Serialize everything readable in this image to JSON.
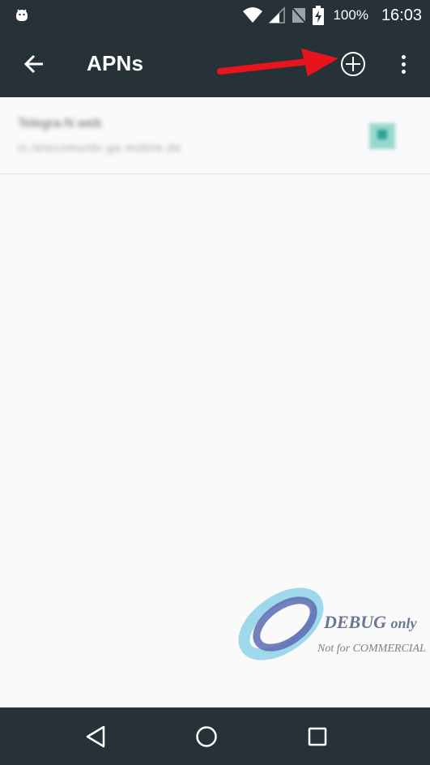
{
  "status_bar": {
    "battery_percent": "100%",
    "time": "16:03",
    "icons": [
      "android-debug-icon",
      "wifi-icon",
      "cell-signal-icon",
      "no-sim-icon",
      "battery-charging-icon"
    ]
  },
  "toolbar": {
    "title": "APNs",
    "back_icon": "arrow-back-icon",
    "add_icon": "add-circle-icon",
    "overflow_icon": "more-vert-icon"
  },
  "apn_list": [
    {
      "name": "Telegra-N web",
      "apn": "in.telecomunbr.ga.mobile.de",
      "selected": true
    }
  ],
  "watermark": {
    "debug": "DEBUG",
    "only": "only",
    "not_for": "Not for COMMERCIAL"
  },
  "nav_bar": {
    "icons": [
      "back-triangle-icon",
      "home-circle-icon",
      "recents-square-icon"
    ]
  },
  "colors": {
    "bar_bg": "#263238",
    "accent": "#2aa394",
    "annotation_arrow": "#e8141c",
    "background": "#fafafa"
  }
}
